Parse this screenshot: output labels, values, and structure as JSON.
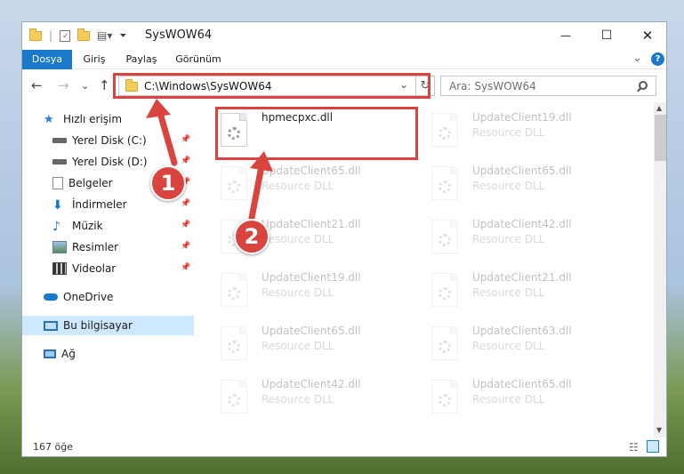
{
  "window": {
    "title": "SysWOW64",
    "minimize": "—",
    "maximize": "☐",
    "close": "✕",
    "help": "?",
    "expand": "⌄"
  },
  "ribbon": {
    "tabs": [
      "Dosya",
      "Giriş",
      "Paylaş",
      "Görünüm"
    ]
  },
  "nav": {
    "back": "←",
    "forward": "→",
    "recent": "⌄",
    "up": "↑",
    "refresh": "↻",
    "dropdown": "⌄"
  },
  "address": {
    "path": "C:\\Windows\\SysWOW64"
  },
  "search": {
    "placeholder": "Ara: SysWOW64",
    "icon": "search-icon"
  },
  "sidebar": {
    "items": [
      {
        "label": "Hızlı erişim",
        "icon": "star-icon"
      },
      {
        "label": "Yerel Disk (C:)",
        "icon": "drive-icon",
        "pinned": true
      },
      {
        "label": "Yerel Disk (D:)",
        "icon": "drive-icon",
        "pinned": true
      },
      {
        "label": "Belgeler",
        "icon": "documents-icon",
        "pinned": true
      },
      {
        "label": "İndirmeler",
        "icon": "download-icon",
        "pinned": true
      },
      {
        "label": "Müzik",
        "icon": "music-icon",
        "pinned": true
      },
      {
        "label": "Resimler",
        "icon": "pictures-icon",
        "pinned": true
      },
      {
        "label": "Videolar",
        "icon": "videos-icon",
        "pinned": true
      },
      {
        "label": "OneDrive",
        "icon": "cloud-icon"
      },
      {
        "label": "Bu bilgisayar",
        "icon": "computer-icon",
        "selected": true
      },
      {
        "label": "Ağ",
        "icon": "network-icon"
      }
    ]
  },
  "files": [
    {
      "name": "hpmecpxc.dll",
      "type": ""
    },
    {
      "name": "UpdateClient19.dll",
      "type": "Resource DLL"
    },
    {
      "name": "UpdateClient65.dll",
      "type": "Resource DLL"
    },
    {
      "name": "UpdateClient65.dll",
      "type": "Resource DLL"
    },
    {
      "name": "UpdateClient21.dll",
      "type": "Resource DLL"
    },
    {
      "name": "UpdateClient42.dll",
      "type": "Resource DLL"
    },
    {
      "name": "UpdateClient19.dll",
      "type": "Resource DLL"
    },
    {
      "name": "UpdateClient21.dll",
      "type": "Resource DLL"
    },
    {
      "name": "UpdateClient65.dll",
      "type": "Resource DLL"
    },
    {
      "name": "UpdateClient63.dll",
      "type": "Resource DLL"
    },
    {
      "name": "UpdateClient42.dll",
      "type": "Resource DLL"
    },
    {
      "name": "UpdateClient65.dll",
      "type": "Resource DLL"
    }
  ],
  "status": {
    "count": "167 öğe"
  },
  "annotations": {
    "step1": "1",
    "step2": "2",
    "color": "#d9443f"
  },
  "colors": {
    "accent": "#1979ca",
    "selection": "#cde8ff"
  }
}
